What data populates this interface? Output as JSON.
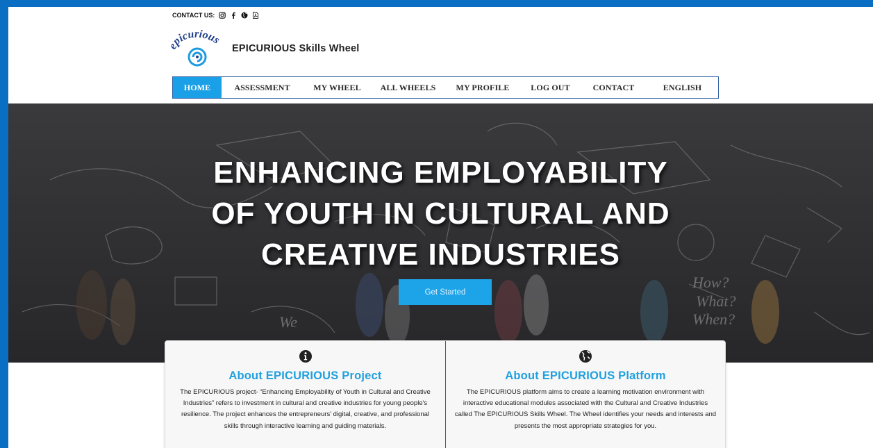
{
  "header": {
    "contact_label": "CONTACT US:",
    "social_icons": [
      "instagram-icon",
      "facebook-icon",
      "globe-icon",
      "pdf-icon"
    ],
    "site_title": "EPICURIOUS Skills Wheel",
    "logo_text": "epicurious"
  },
  "nav": {
    "items": [
      "HOME",
      "ASSESSMENT",
      "MY WHEEL",
      "ALL WHEELS",
      "MY PROFILE",
      "LOG OUT",
      "CONTACT",
      "ENGLISH"
    ],
    "active": "HOME"
  },
  "hero": {
    "title_line1": "ENHANCING EMPLOYABILITY",
    "title_line2": "OF YOUTH IN CULTURAL AND",
    "title_line3": "CREATIVE INDUSTRIES",
    "cta_label": "Get Started",
    "sketch_words": [
      "How?",
      "What?",
      "When?",
      "We"
    ]
  },
  "cards": [
    {
      "icon": "info-icon",
      "title": "About EPICURIOUS Project",
      "body": "The EPICURIOUS project- “Enhancing Employability of Youth in Cultural and Creative Industries” refers to investment in cultural and creative industries for young people's resilience. The project enhances the entrepreneurs' digital, creative, and professional skills through interactive learning and guiding materials."
    },
    {
      "icon": "globe-icon",
      "title": "About EPICURIOUS Platform",
      "body": "The EPICURIOUS platform aims to create a learning motivation environment with interactive educational modules associated with the Cultural and Creative Industries called The EPICURIOUS Skills Wheel. The Wheel identifies your needs and interests and presents the most appropriate strategies for you."
    }
  ],
  "colors": {
    "frame": "#0a6fc2",
    "accent": "#1aa0e6",
    "nav_border": "#2f5fa5",
    "hero_bg": "#2e2e30"
  }
}
